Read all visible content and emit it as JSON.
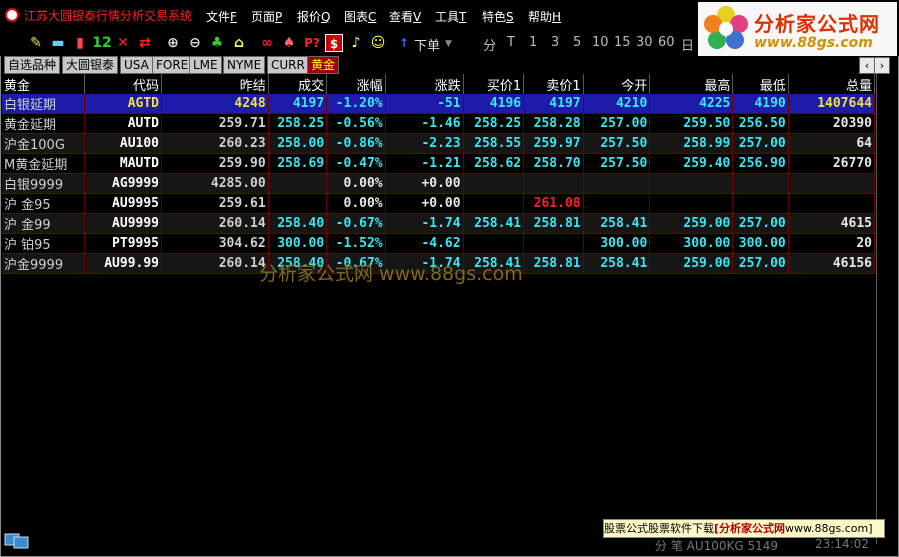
{
  "window": {
    "title": "江苏大圆银泰行情分析交易系统"
  },
  "menu": [
    {
      "label": "文件",
      "key": "F"
    },
    {
      "label": "页面",
      "key": "P"
    },
    {
      "label": "报价",
      "key": "Q"
    },
    {
      "label": "图表",
      "key": "C"
    },
    {
      "label": "查看",
      "key": "V"
    },
    {
      "label": "工具",
      "key": "T"
    },
    {
      "label": "特色",
      "key": "S"
    },
    {
      "label": "帮助",
      "key": "H"
    }
  ],
  "logo": {
    "name": "分析家公式网",
    "url": "www.88gs.com"
  },
  "toolbar": {
    "count_label": "12",
    "pq_label": "P?",
    "order_label": "下单",
    "periods": [
      "分",
      "T",
      "1",
      "3",
      "5",
      "10",
      "15",
      "30",
      "60",
      "日"
    ]
  },
  "tabs": [
    "自选品种",
    "大圆银泰",
    "USA",
    "FORE",
    "LME",
    "NYME",
    "CURR",
    "黄金"
  ],
  "table": {
    "headers": [
      "黄金",
      "代码",
      "昨结",
      "成交",
      "涨幅",
      "涨跌",
      "买价1",
      "卖价1",
      "今开",
      "最高",
      "最低",
      "总量"
    ],
    "rows": [
      {
        "name": "白银延期",
        "code": "AGTD",
        "prev": "4248",
        "last": "4197",
        "pct": "-1.20%",
        "chg": "-51",
        "bid": "4196",
        "ask": "4197",
        "open": "4210",
        "high": "4225",
        "low": "4190",
        "vol": "1407644"
      },
      {
        "name": "黄金延期",
        "code": "AUTD",
        "prev": "259.71",
        "last": "258.25",
        "pct": "-0.56%",
        "chg": "-1.46",
        "bid": "258.25",
        "ask": "258.28",
        "open": "257.00",
        "high": "259.50",
        "low": "256.50",
        "vol": "20390"
      },
      {
        "name": "沪金100G",
        "code": "AU100",
        "prev": "260.23",
        "last": "258.00",
        "pct": "-0.86%",
        "chg": "-2.23",
        "bid": "258.55",
        "ask": "259.97",
        "open": "257.50",
        "high": "258.99",
        "low": "257.00",
        "vol": "64"
      },
      {
        "name": "M黄金延期",
        "code": "MAUTD",
        "prev": "259.90",
        "last": "258.69",
        "pct": "-0.47%",
        "chg": "-1.21",
        "bid": "258.62",
        "ask": "258.70",
        "open": "257.50",
        "high": "259.40",
        "low": "256.90",
        "vol": "26770"
      },
      {
        "name": "白银9999",
        "code": "AG9999",
        "prev": "4285.00",
        "last": "",
        "pct": "0.00%",
        "chg": "+0.00",
        "bid": "",
        "ask": "",
        "open": "",
        "high": "",
        "low": "",
        "vol": ""
      },
      {
        "name": "沪  金95",
        "code": "AU9995",
        "prev": "259.61",
        "last": "",
        "pct": "0.00%",
        "chg": "+0.00",
        "bid": "",
        "ask": "261.08",
        "open": "",
        "high": "",
        "low": "",
        "vol": ""
      },
      {
        "name": "沪  金99",
        "code": "AU9999",
        "prev": "260.14",
        "last": "258.40",
        "pct": "-0.67%",
        "chg": "-1.74",
        "bid": "258.41",
        "ask": "258.81",
        "open": "258.41",
        "high": "259.00",
        "low": "257.00",
        "vol": "4615"
      },
      {
        "name": "沪  铂95",
        "code": "PT9995",
        "prev": "304.62",
        "last": "300.00",
        "pct": "-1.52%",
        "chg": "-4.62",
        "bid": "",
        "ask": "",
        "open": "300.00",
        "high": "300.00",
        "low": "300.00",
        "vol": "20"
      },
      {
        "name": "沪金9999",
        "code": "AU99.99",
        "prev": "260.14",
        "last": "258.40",
        "pct": "-0.67%",
        "chg": "-1.74",
        "bid": "258.41",
        "ask": "258.81",
        "open": "258.41",
        "high": "259.00",
        "low": "257.00",
        "vol": "46156"
      }
    ]
  },
  "watermark": "分析家公式网 www.88gs.com",
  "statusbar": {
    "ad_prefix": "股票公式股票软件下载",
    "ad_link": "[分析家公式网",
    "ad_suffix": "www.88gs.com]",
    "text": "分  笔 AU100KG 5149",
    "time": "23:14:02"
  },
  "colors": {
    "gold": "#f0e040",
    "cyan": "#38e8f0",
    "red": "#ff2020",
    "selected_row": "#1c1ca8",
    "grid": "#6a0000"
  }
}
